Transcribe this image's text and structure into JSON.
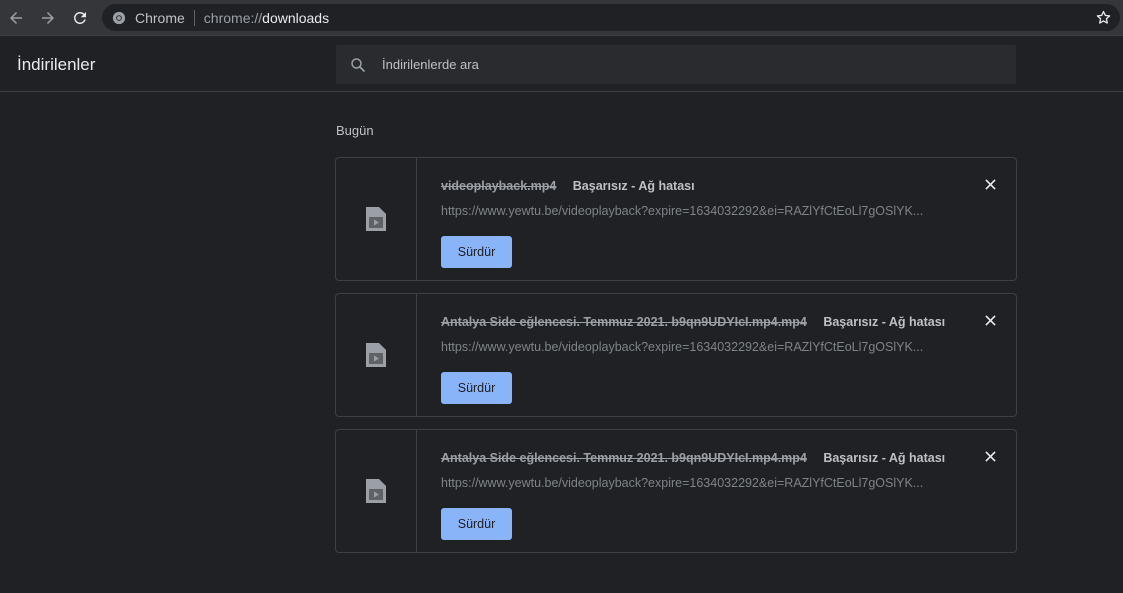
{
  "browser": {
    "chip_label": "Chrome",
    "url_scheme": "chrome://",
    "url_host": "downloads"
  },
  "downloads_page": {
    "title": "İndirilenler",
    "search_placeholder": "İndirilenlerde ara",
    "section_label": "Bugün"
  },
  "items": [
    {
      "file_name": "videoplayback.mp4",
      "status": "Başarısız - Ağ hatası",
      "url": "https://www.yewtu.be/videoplayback?expire=1634032292&ei=RAZlYfCtEoLl7gOSlYK...",
      "resume_label": "Sürdür"
    },
    {
      "file_name": "Antalya Side eğlencesi. Temmuz 2021. b9qn9UDYIcI.mp4.mp4",
      "status": "Başarısız - Ağ hatası",
      "url": "https://www.yewtu.be/videoplayback?expire=1634032292&ei=RAZlYfCtEoLl7gOSlYK...",
      "resume_label": "Sürdür"
    },
    {
      "file_name": "Antalya Side eğlencesi. Temmuz 2021. b9qn9UDYIcI.mp4.mp4",
      "status": "Başarısız - Ağ hatası",
      "url": "https://www.yewtu.be/videoplayback?expire=1634032292&ei=RAZlYfCtEoLl7gOSlYK...",
      "resume_label": "Sürdür"
    }
  ],
  "icons": {
    "back": "back-arrow-icon",
    "forward": "forward-arrow-icon",
    "reload": "reload-icon",
    "site": "chrome-logo-icon",
    "bookmark": "star-icon",
    "search": "search-icon",
    "file": "video-file-icon",
    "close": "close-icon"
  },
  "colors": {
    "background": "#202124",
    "toolbar": "#35363a",
    "accent": "#8ab4f8",
    "border": "#3c4043"
  }
}
